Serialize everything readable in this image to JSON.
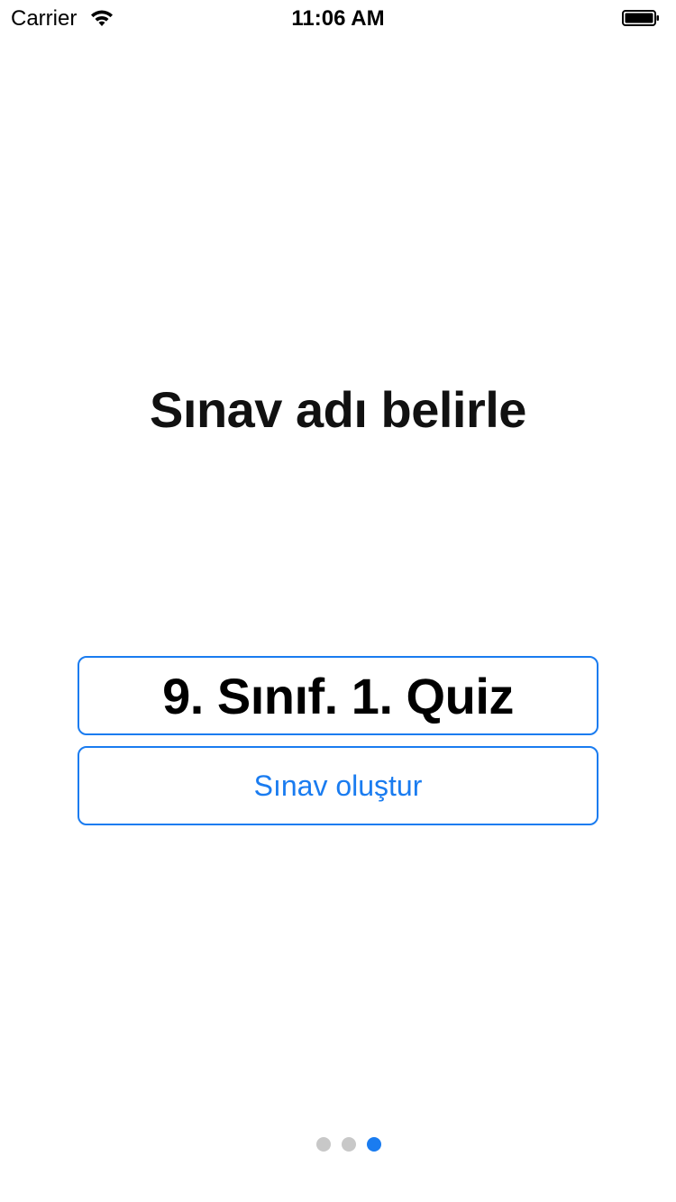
{
  "status_bar": {
    "carrier": "Carrier",
    "time": "11:06 AM",
    "wifi_icon": "wifi-icon",
    "battery_icon": "battery-icon"
  },
  "main": {
    "title": "Sınav adı belirle",
    "quiz_name_value": "9. Sınıf. 1. Quiz",
    "create_button_label": "Sınav oluştur"
  },
  "page_control": {
    "total_pages": 3,
    "current_page": 3
  },
  "colors": {
    "accent": "#1a7cf0",
    "dot_inactive": "#c8c8c8",
    "text": "#111111",
    "background": "#ffffff"
  }
}
